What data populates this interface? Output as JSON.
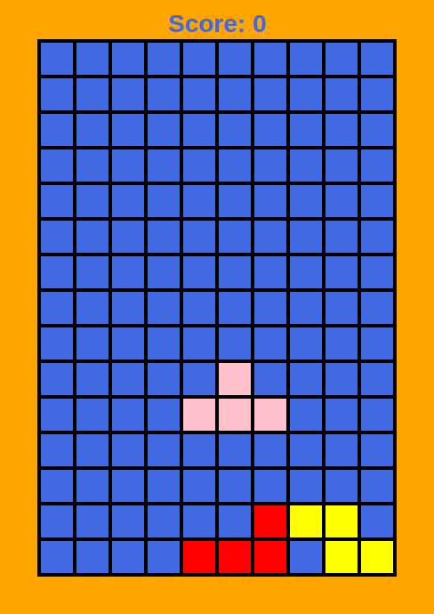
{
  "score": {
    "label": "Score: 0"
  },
  "board": {
    "columns": 10,
    "rows": [
      [
        null,
        null,
        null,
        null,
        null,
        null,
        null,
        null,
        null,
        null
      ],
      [
        null,
        null,
        null,
        null,
        null,
        null,
        null,
        null,
        null,
        null
      ],
      [
        null,
        null,
        null,
        null,
        null,
        null,
        null,
        null,
        null,
        null
      ],
      [
        null,
        null,
        null,
        null,
        null,
        null,
        null,
        null,
        null,
        null
      ],
      [
        null,
        null,
        null,
        null,
        null,
        null,
        null,
        null,
        null,
        null
      ],
      [
        null,
        null,
        null,
        null,
        null,
        null,
        null,
        null,
        null,
        null
      ],
      [
        null,
        null,
        null,
        null,
        null,
        null,
        null,
        null,
        null,
        null
      ],
      [
        null,
        null,
        null,
        null,
        null,
        null,
        null,
        null,
        null,
        null
      ],
      [
        null,
        null,
        null,
        null,
        null,
        null,
        null,
        null,
        null,
        null
      ],
      [
        null,
        null,
        null,
        null,
        null,
        "#ffc0cb",
        null,
        null,
        null,
        null
      ],
      [
        null,
        null,
        null,
        null,
        "#ffc0cb",
        "#ffc0cb",
        "#ffc0cb",
        null,
        null,
        null
      ],
      [
        null,
        null,
        null,
        null,
        null,
        null,
        null,
        null,
        null,
        null
      ],
      [
        null,
        null,
        null,
        null,
        null,
        null,
        null,
        null,
        null,
        null
      ],
      [
        null,
        null,
        null,
        null,
        null,
        null,
        "#ff0000",
        "#ffff00",
        "#ffff00",
        null
      ],
      [
        null,
        null,
        null,
        null,
        "#ff0000",
        "#ff0000",
        "#ff0000",
        null,
        "#ffff00",
        "#ffff00"
      ]
    ]
  }
}
